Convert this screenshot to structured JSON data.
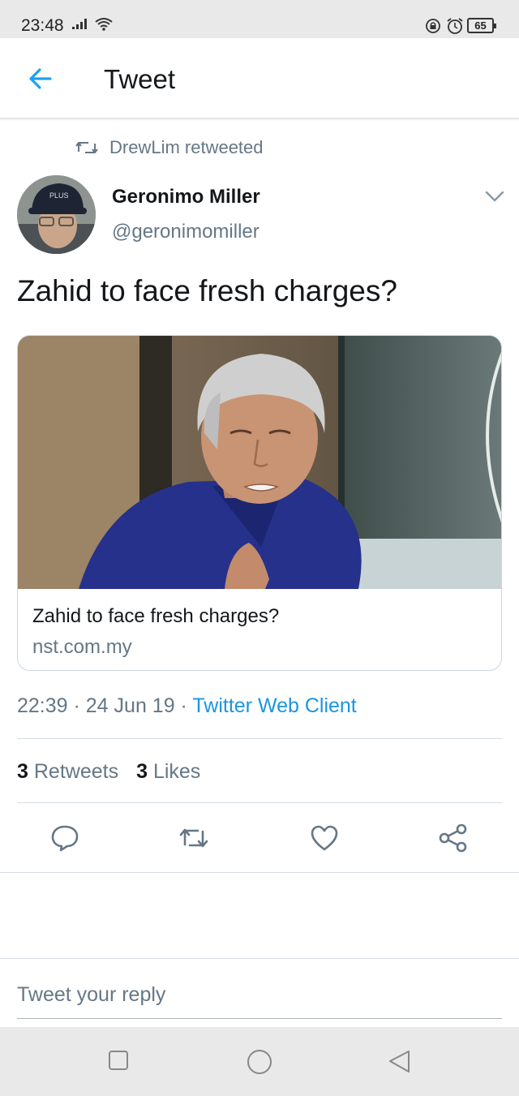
{
  "status_bar": {
    "time": "23:48",
    "battery": "65",
    "icons": [
      "signal-icon",
      "wifi-icon",
      "lock-rotate-icon",
      "alarm-icon",
      "battery-icon"
    ]
  },
  "header": {
    "title": "Tweet",
    "back_icon": "arrow-left-icon"
  },
  "tweet": {
    "retweet_context": "DrewLim retweeted",
    "author_name": "Geronimo Miller",
    "author_handle": "@geronimomiller",
    "text": "Zahid to face fresh charges?",
    "card": {
      "title": "Zahid to face fresh charges?",
      "domain": "nst.com.my"
    },
    "time": "22:39",
    "date": "24 Jun 19",
    "separator": " · ",
    "source": "Twitter Web Client",
    "retweets_count": "3",
    "retweets_label": "Retweets",
    "likes_count": "3",
    "likes_label": "Likes"
  },
  "actions": [
    "reply-icon",
    "retweet-icon",
    "like-icon",
    "share-icon"
  ],
  "reply_box": {
    "placeholder": "Tweet your reply"
  },
  "nav_bar": [
    "recent-apps-icon",
    "home-icon",
    "back-icon"
  ],
  "colors": {
    "accent": "#1da1f2",
    "link": "#1b95e0",
    "secondary_text": "#657786",
    "primary_text": "#14171a",
    "divider": "#d5dde3"
  }
}
